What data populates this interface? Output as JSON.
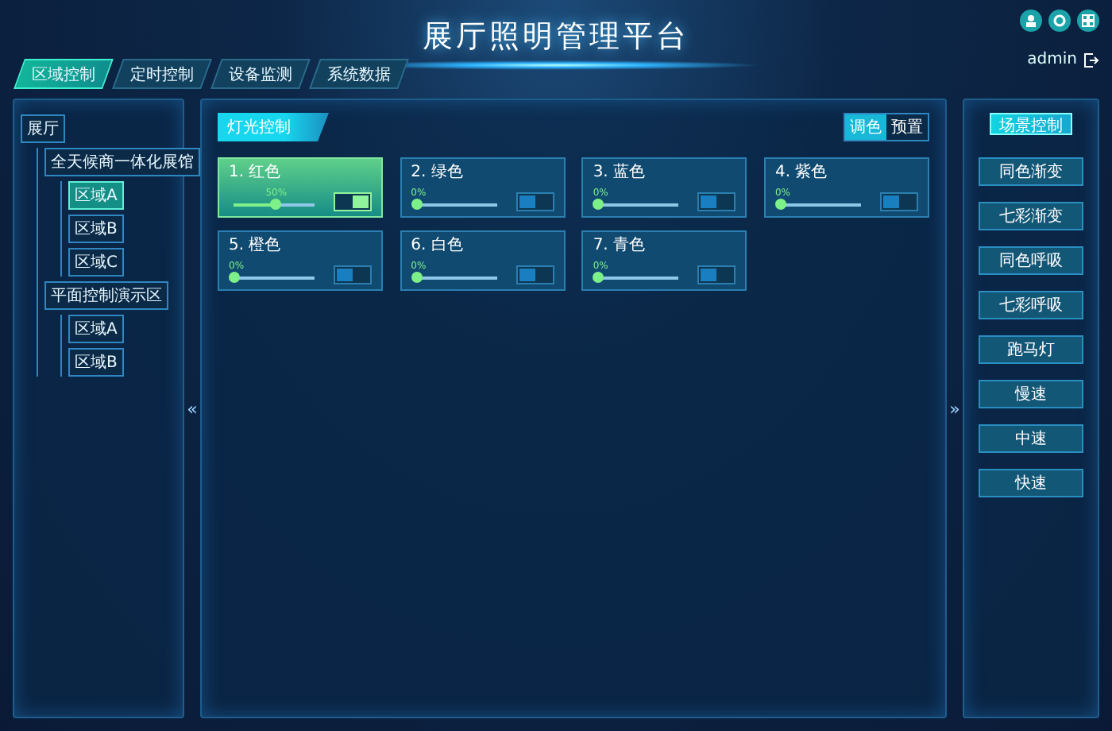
{
  "title": "展厅照明管理平台",
  "header_icons": [
    {
      "kind": "user"
    },
    {
      "kind": "settings"
    },
    {
      "kind": "grid"
    }
  ],
  "user": {
    "name": "admin"
  },
  "tabs": [
    {
      "label": "区域控制",
      "selected": true
    },
    {
      "label": "定时控制",
      "selected": false
    },
    {
      "label": "设备监测",
      "selected": false
    },
    {
      "label": "系统数据",
      "selected": false
    }
  ],
  "tree": [
    {
      "label": "展厅",
      "selected": false,
      "children": [
        {
          "label": "全天候商一体化展馆",
          "selected": false,
          "children": [
            {
              "label": "区域A",
              "selected": true
            },
            {
              "label": "区域B",
              "selected": false
            },
            {
              "label": "区域C",
              "selected": false
            }
          ]
        },
        {
          "label": "平面控制演示区",
          "selected": false,
          "children": [
            {
              "label": "区域A",
              "selected": false
            },
            {
              "label": "区域B",
              "selected": false
            }
          ]
        }
      ]
    }
  ],
  "collapse_left": "«",
  "collapse_right": "»",
  "panel": {
    "title": "灯光控制",
    "modes": [
      {
        "label": "调色",
        "selected": true
      },
      {
        "label": "预置",
        "selected": false
      }
    ],
    "lights": [
      {
        "name": "1. 红色",
        "reading": "50%",
        "level": 0.5,
        "on": true
      },
      {
        "name": "2. 绿色",
        "reading": "0%",
        "level": 0,
        "on": false
      },
      {
        "name": "3. 蓝色",
        "reading": "0%",
        "level": 0,
        "on": false
      },
      {
        "name": "4. 紫色",
        "reading": "0%",
        "level": 0,
        "on": false
      },
      {
        "name": "5. 橙色",
        "reading": "0%",
        "level": 0,
        "on": false
      },
      {
        "name": "6. 白色",
        "reading": "0%",
        "level": 0,
        "on": false
      },
      {
        "name": "7. 青色",
        "reading": "0%",
        "level": 0,
        "on": false
      }
    ]
  },
  "scene": {
    "title": "场景控制",
    "buttons": [
      "同色渐变",
      "七彩渐变",
      "同色呼吸",
      "七彩呼吸",
      "跑马灯",
      "慢速",
      "中速",
      "快速"
    ]
  }
}
